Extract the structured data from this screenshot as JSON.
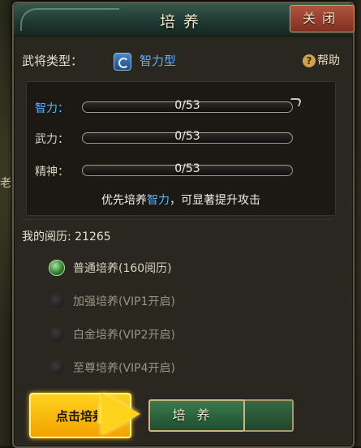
{
  "window": {
    "title": "培养",
    "close_label": "关闭"
  },
  "general_type": {
    "label": "武将类型：",
    "value": "智力型",
    "icon": "intellect-icon"
  },
  "help_label": "帮助",
  "attributes": [
    {
      "label": "智力：",
      "value": "0/53",
      "active": true
    },
    {
      "label": "武力：",
      "value": "0/53",
      "active": false
    },
    {
      "label": "精神：",
      "value": "0/53",
      "active": false
    }
  ],
  "hint": {
    "prefix": "优先培养",
    "attr": "智力",
    "suffix": "，可显著提升攻击"
  },
  "experience": {
    "label": "我的阅历:",
    "value": "21265"
  },
  "options": [
    {
      "label": "普通培养(160阅历)",
      "selected": true,
      "enabled": true
    },
    {
      "label": "加强培养(VIP1开启)",
      "selected": false,
      "enabled": false
    },
    {
      "label": "白金培养(VIP2开启)",
      "selected": false,
      "enabled": false
    },
    {
      "label": "至尊培养(VIP4开启)",
      "selected": false,
      "enabled": false
    }
  ],
  "train_button_label": "培养",
  "tutorial": {
    "label": "点击培养"
  },
  "colors": {
    "accent_blue": "#58b2ff",
    "title_green": "#1f3a33",
    "close_red": "#7e2e20",
    "tutorial_yellow": "#ffd21e"
  }
}
